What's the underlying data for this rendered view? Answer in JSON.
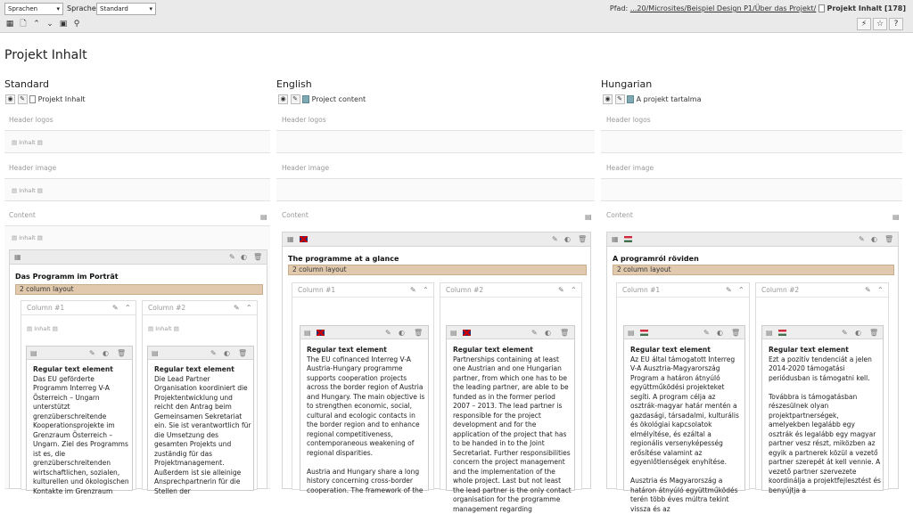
{
  "toolbar": {
    "language_select": "Sprachen",
    "sprache_label": "Sprache:",
    "sprache_value": "Standard"
  },
  "breadcrumb": {
    "label": "Pfad:",
    "path": "...20/Microsites/Beispiel Design P1/Über das Projekt/",
    "current": "Projekt Inhalt [178]"
  },
  "page_title": "Projekt Inhalt",
  "columns": [
    {
      "lang": "Standard",
      "page": "Projekt Inhalt",
      "header_logos": "Header logos",
      "header_image": "Header image",
      "content": "Content",
      "inhalt": "Inhalt",
      "container_title": "Das Programm im Porträt",
      "layout": "2 column layout",
      "col1": "Column #1",
      "col2": "Column #2",
      "el1_title": "Regular text element",
      "el1_text": "Das EU geförderte Programm Interreg V-A Österreich – Ungarn unterstützt grenzüberschreitende Kooperationsprojekte im Grenzraum Österreich – Ungarn. Ziel des Programms ist es, die grenzüberschreitenden wirtschaftlichen, sozialen, kulturellen und ökologischen Kontakte im Grenzraum",
      "el2_title": "Regular text element",
      "el2_text": "Die Lead Partner Organisation koordiniert die Projektentwicklung und reicht den Antrag beim Gemeinsamen Sekretariat ein. Sie ist verantwortlich für die Umsetzung des gesamten Projekts und zuständig für das Projektmanagement. Außerdem ist sie alleinige Ansprechpartnerin für die Stellen der"
    },
    {
      "lang": "English",
      "page": "Project content",
      "header_logos": "Header logos",
      "header_image": "Header image",
      "content": "Content",
      "container_title": "The programme at a glance",
      "layout": "2 column layout",
      "col1": "Column #1",
      "col2": "Column #2",
      "el1_title": "Regular text element",
      "el1_text": "The EU cofinanced Interreg V-A Austria-Hungary programme supports cooperation projects across the border region of Austria and Hungary. The main objective is to strengthen economic, social, cultural and ecologic contacts in the border region and to enhance regional competitiveness, contemporaneous weakening of regional disparities.",
      "el1_text2": "Austria and Hungary share a long history concerning cross-border cooperation. The framework of the",
      "el2_title": "Regular text element",
      "el2_text": "Partnerships containing at least one Austrian and one Hungarian partner, from which one has to be the leading partner, are able to be funded as in the former period 2007 – 2013. The lead partner is responsible for the project development and for the application of the project that has to be handed in to the Joint Secretariat. Further responsibilities concern the project management and the implementation of the whole project. Last but not least the lead partner is the only contact organisation for the programme management regarding"
    },
    {
      "lang": "Hungarian",
      "page": "A projekt tartalma",
      "header_logos": "Header logos",
      "header_image": "Header image",
      "content": "Content",
      "container_title": "A programról röviden",
      "layout": "2 column layout",
      "col1": "Column #1",
      "col2": "Column #2",
      "el1_title": "Regular text element",
      "el1_text": "Az EU által támogatott Interreg V-A Ausztria-Magyarország Program a határon átnyúló együttműködési projekteket segíti. A program célja az osztrák-magyar határ mentén a gazdasági, társadalmi, kulturális és ökológiai kapcsolatok elmélyítése, és ezáltal a regionális versenyképesség erősítése valamint az egyenlőtlenségek enyhítése.",
      "el1_text2": "Ausztria és Magyarország a határon átnyúló együttműködés terén több éves múltra tekint vissza és az",
      "el2_title": "Regular text element",
      "el2_text": "Ezt a pozitív tendenciát a jelen 2014-2020 támogatási periódusban is támogatni kell.",
      "el2_text2": "Továbbra is támogatásban részesülnek olyan projektpartnerségek, amelyekben legalább egy osztrák és legalább egy magyar partner vesz részt, miközben az egyik a partnerek közül a vezető partner szerepét át kell vennie. A vezető partner szervezete koordinálja a projektfejlesztést és benyújtja a"
    }
  ]
}
